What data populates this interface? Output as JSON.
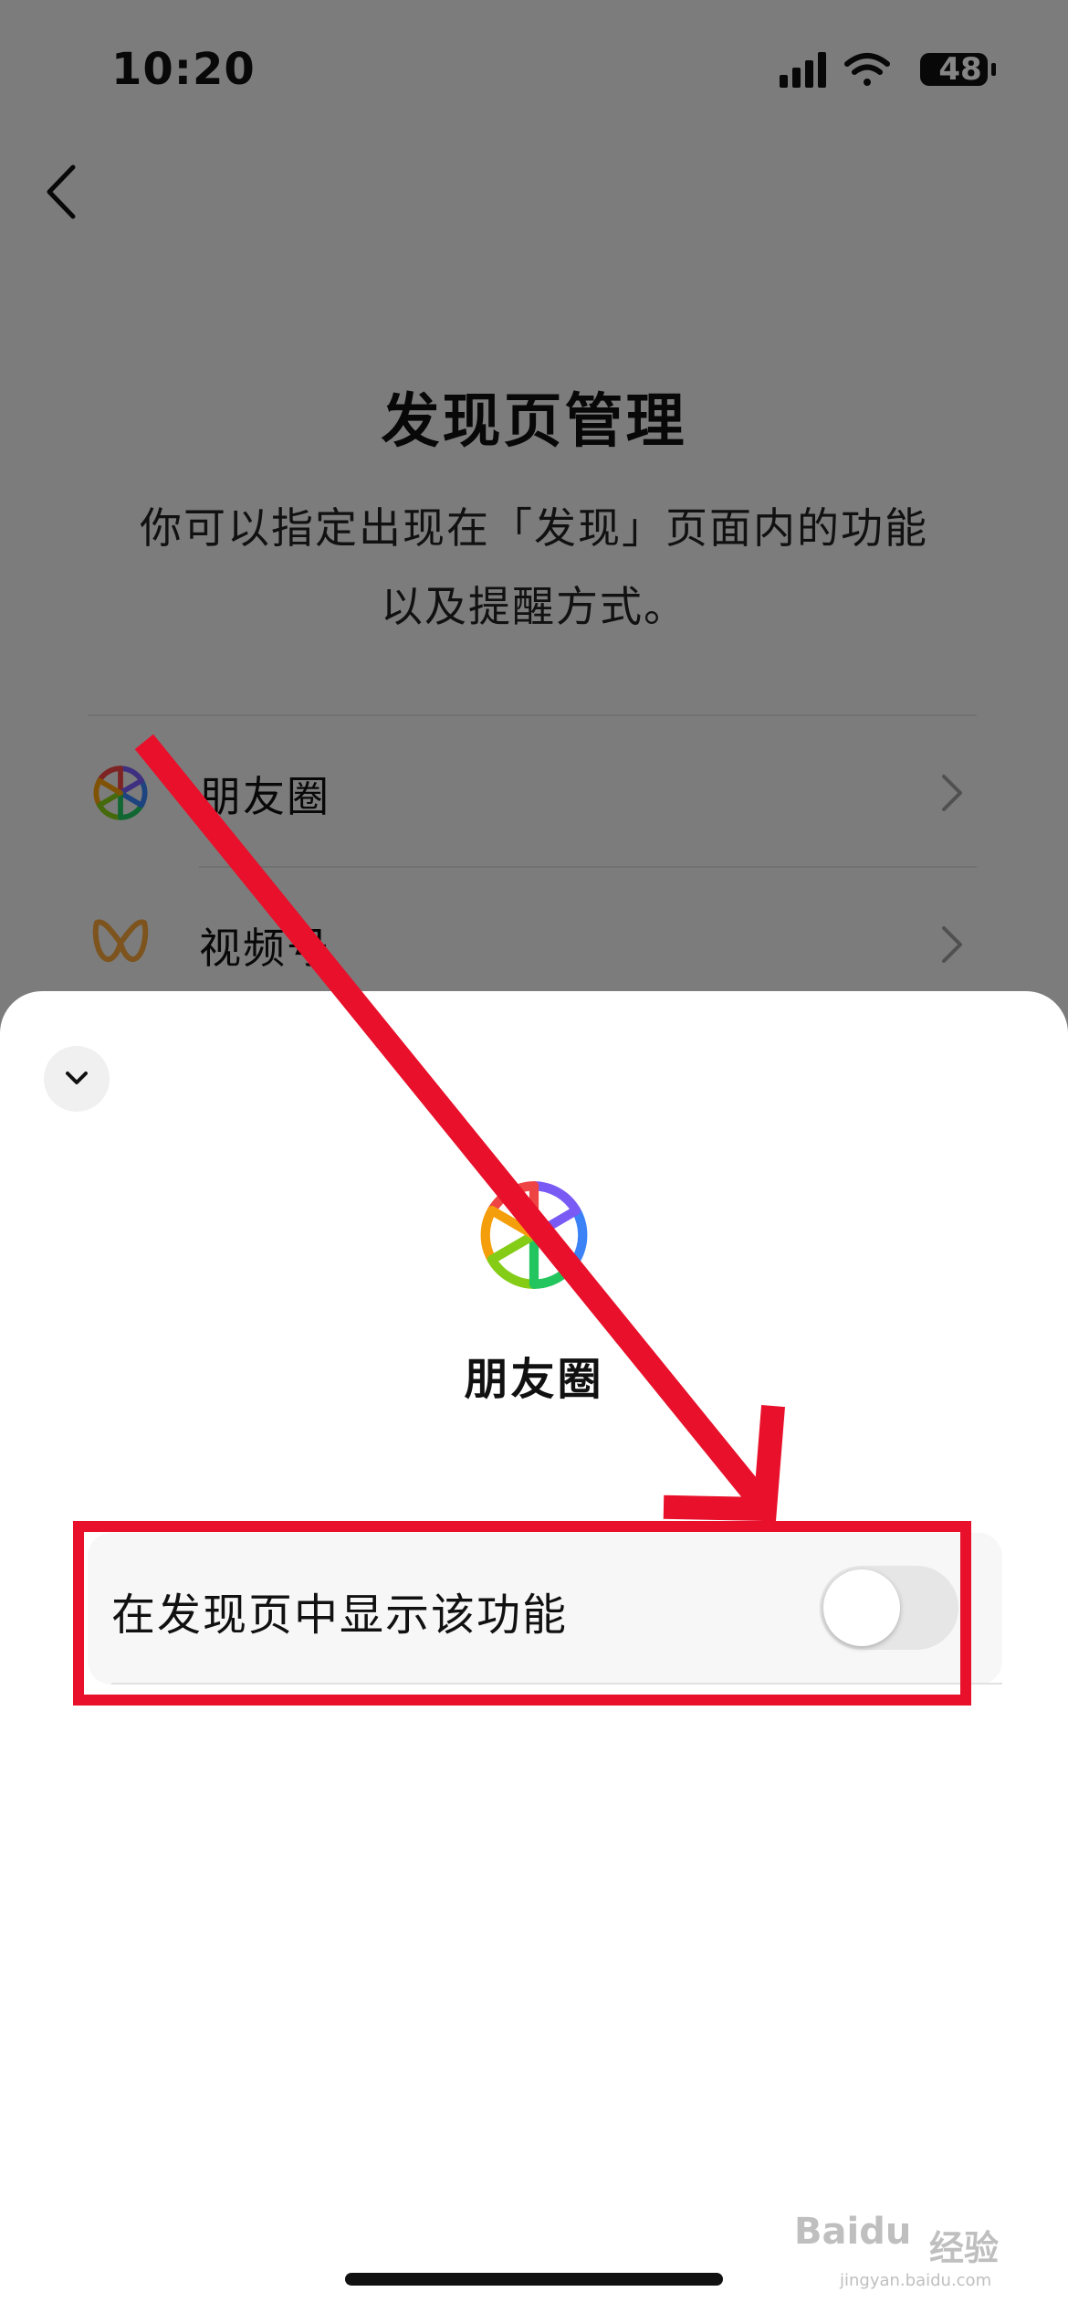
{
  "status_bar": {
    "time": "10:20",
    "battery": "48"
  },
  "background_page": {
    "title": "发现页管理",
    "description_line1": "你可以指定出现在「发现」页面内的功能",
    "description_line2": "以及提醒方式。",
    "items": [
      {
        "label": "朋友圈",
        "icon": "moments-icon"
      },
      {
        "label": "视频号",
        "icon": "channels-icon"
      }
    ]
  },
  "sheet": {
    "title": "朋友圈",
    "icon": "moments-icon",
    "setting": {
      "label": "在发现页中显示该功能",
      "toggle_on": false
    }
  },
  "annotation": {
    "color": "#e8102a"
  },
  "watermark": {
    "logo": "Baidu",
    "text": "经验",
    "subtext": "jingyan.baidu.com"
  },
  "colors": {
    "accent_red": "#e8102a",
    "sheet_bg": "#ffffff",
    "toggle_off": "#e6e6e6"
  }
}
